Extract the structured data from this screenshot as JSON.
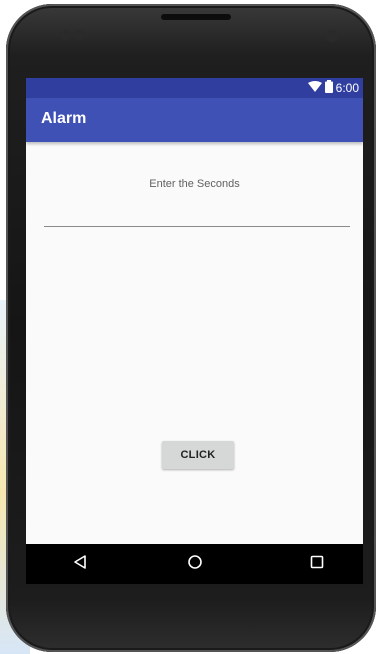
{
  "status_bar": {
    "time": "6:00",
    "icons": [
      "wifi-icon",
      "battery-icon"
    ]
  },
  "app_bar": {
    "title": "Alarm"
  },
  "content": {
    "prompt": "Enter the Seconds",
    "seconds_input": {
      "value": "",
      "placeholder": ""
    },
    "button_label": "CLICK"
  },
  "nav_bar": {
    "icons": [
      "back-icon",
      "home-icon",
      "recent-apps-icon"
    ]
  },
  "colors": {
    "primary": "#3f51b5",
    "primary_dark": "#303f9f",
    "button": "#d6d7d7",
    "background": "#fafafa"
  }
}
